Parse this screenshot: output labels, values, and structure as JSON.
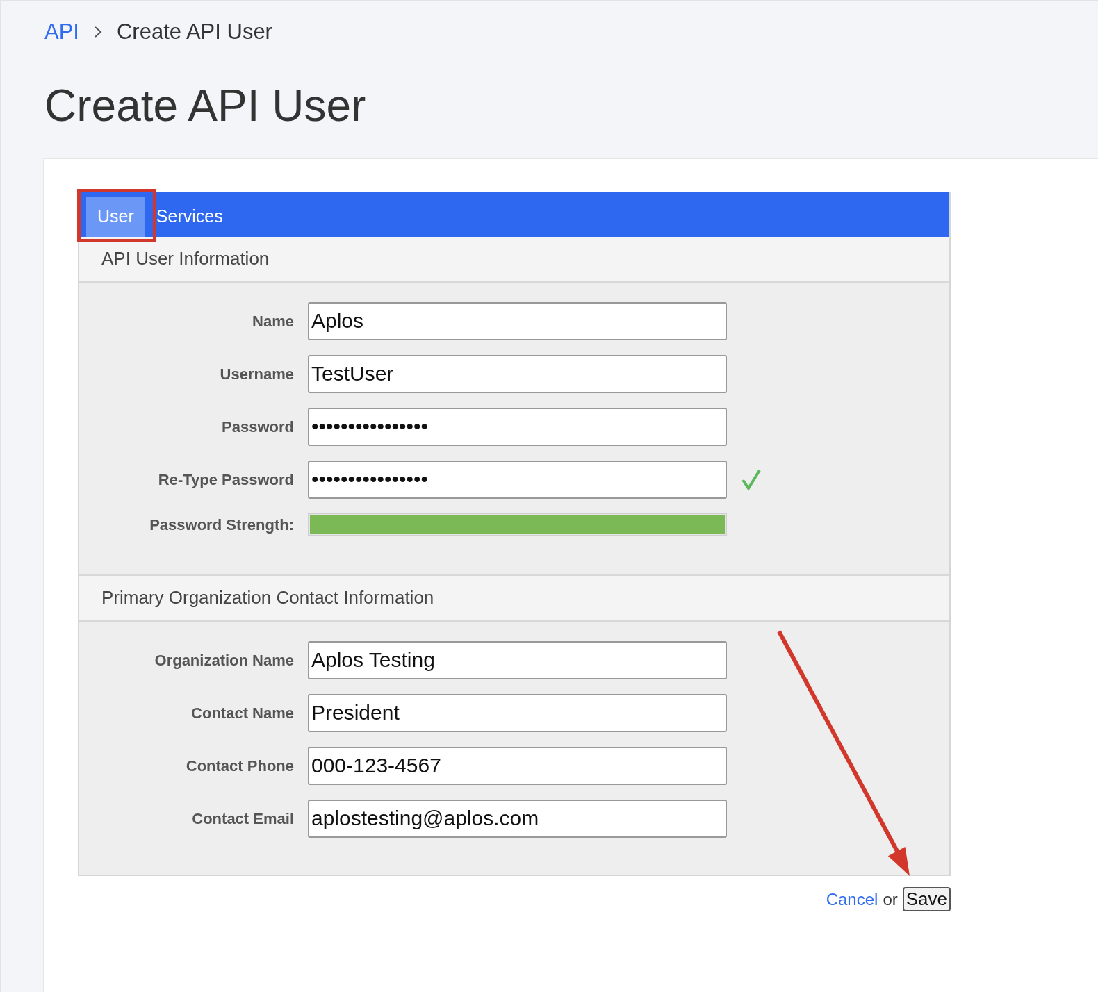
{
  "breadcrumb": [
    {
      "label": "API",
      "kind": "link"
    },
    {
      "label": "Create API User",
      "kind": "current"
    }
  ],
  "title": "Create API User",
  "tabs": [
    {
      "label": "User",
      "selected": true
    },
    {
      "label": "Services",
      "selected": false
    }
  ],
  "sections": [
    {
      "title": "API User Information",
      "fields": [
        {
          "label": "Name",
          "value": "Aplos",
          "kind": "text"
        },
        {
          "label": "Username",
          "value": "TestUser",
          "kind": "text"
        },
        {
          "label": "Password",
          "value": "••••••••••••••••",
          "kind": "text"
        },
        {
          "label": "Re-Type Password",
          "value": "••••••••••••••••",
          "kind": "text",
          "valid": true
        },
        {
          "label": "Password Strength:",
          "kind": "meter",
          "level": 1.0
        }
      ]
    },
    {
      "title": "Primary Organization Contact Information",
      "fields": [
        {
          "label": "Organization Name",
          "value": "Aplos Testing",
          "kind": "text"
        },
        {
          "label": "Contact Name",
          "value": "President",
          "kind": "text"
        },
        {
          "label": "Contact Phone",
          "value": "000-123-4567",
          "kind": "text"
        },
        {
          "label": "Contact Email",
          "value": "aplostesting@aplos.com",
          "kind": "text"
        }
      ]
    }
  ],
  "actions": {
    "cancel": "Cancel",
    "separator": "or",
    "save": "Save"
  }
}
